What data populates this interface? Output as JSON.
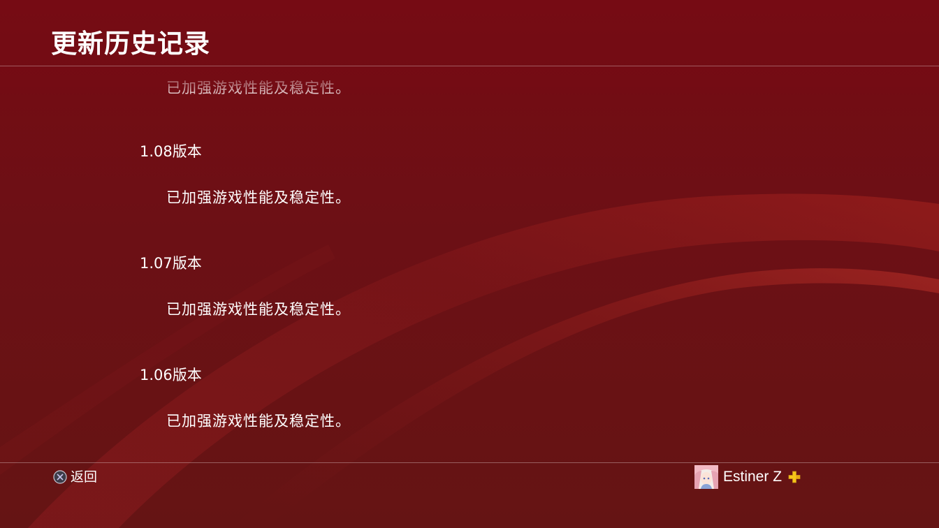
{
  "header": {
    "title": "更新历史记录"
  },
  "updates": {
    "partial_top": {
      "description": "已加强游戏性能及稳定性。"
    },
    "entries": [
      {
        "version": "1.08版本",
        "description": "已加强游戏性能及稳定性。"
      },
      {
        "version": "1.07版本",
        "description": "已加强游戏性能及稳定性。"
      },
      {
        "version": "1.06版本",
        "description": "已加强游戏性能及稳定性。"
      }
    ]
  },
  "footer": {
    "back_label": "返回",
    "back_icon": "cross-button-icon",
    "user_name": "Estiner Z",
    "user_badge_icon": "playstation-plus-icon"
  },
  "colors": {
    "background": "#6c1015",
    "text": "#ffffff",
    "plus_badge": "#f5c518"
  }
}
